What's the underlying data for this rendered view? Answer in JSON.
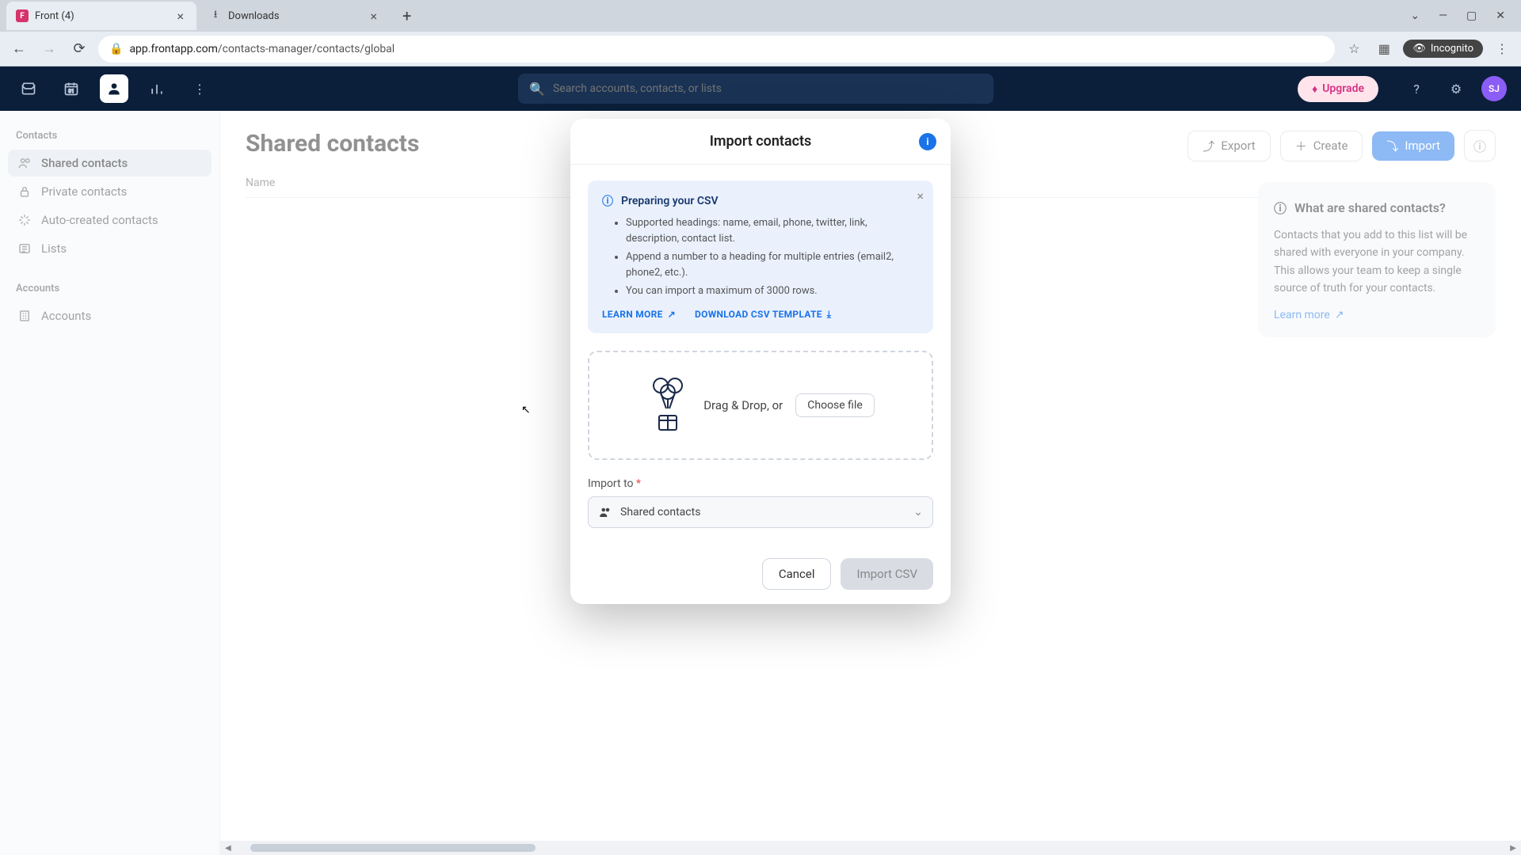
{
  "browser": {
    "tabs": [
      {
        "title": "Front (4)",
        "active": true
      },
      {
        "title": "Downloads",
        "active": false
      }
    ],
    "url_domain": "app.frontapp.com",
    "url_path": "/contacts-manager/contacts/global",
    "incognito": "Incognito"
  },
  "header": {
    "search_placeholder": "Search accounts, contacts, or lists",
    "upgrade": "Upgrade",
    "avatar": "SJ"
  },
  "sidebar": {
    "section_contacts": "Contacts",
    "items_contacts": [
      "Shared contacts",
      "Private contacts",
      "Auto-created contacts",
      "Lists"
    ],
    "section_accounts": "Accounts",
    "items_accounts": [
      "Accounts"
    ]
  },
  "page": {
    "title": "Shared contacts",
    "table_col1": "Name",
    "export": "Export",
    "create": "Create",
    "import": "Import"
  },
  "info_panel": {
    "title": "What are shared contacts?",
    "body": "Contacts that you add to this list will be shared with everyone in your company. This allows your team to keep a single source of truth for your contacts.",
    "link": "Learn more"
  },
  "modal": {
    "title": "Import contacts",
    "callout_title": "Preparing your CSV",
    "callout_items": [
      "Supported headings: name, email, phone, twitter, link, description, contact list.",
      "Append a number to a heading for multiple entries (email2, phone2, etc.).",
      "You can import a maximum of 3000 rows."
    ],
    "learn_more": "LEARN MORE",
    "download_template": "DOWNLOAD CSV TEMPLATE",
    "dropzone_text": "Drag & Drop, or",
    "choose_file": "Choose file",
    "import_to_label": "Import to",
    "import_to_value": "Shared contacts",
    "cancel": "Cancel",
    "import_csv": "Import CSV"
  }
}
